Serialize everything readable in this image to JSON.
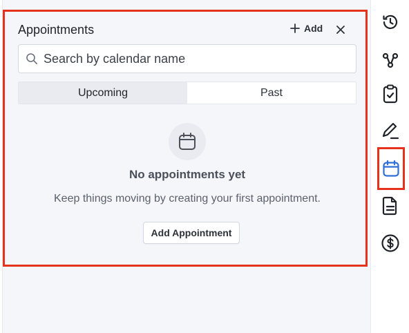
{
  "panel": {
    "title": "Appointments",
    "add_label": "Add",
    "search": {
      "placeholder": "Search by calendar name",
      "value": ""
    },
    "tabs": [
      {
        "label": "Upcoming",
        "active": true
      },
      {
        "label": "Past",
        "active": false
      }
    ],
    "empty_state": {
      "icon": "calendar-icon",
      "title": "No appointments yet",
      "description": "Keep things moving by creating your first appointment.",
      "button_label": "Add Appointment"
    }
  },
  "rail": {
    "items": [
      {
        "name": "history-icon",
        "active": false
      },
      {
        "name": "workflow-icon",
        "active": false
      },
      {
        "name": "tasks-clipboard-icon",
        "active": false
      },
      {
        "name": "pen-icon",
        "active": false
      },
      {
        "name": "calendar-icon",
        "active": true
      },
      {
        "name": "document-icon",
        "active": false
      },
      {
        "name": "payments-dollar-icon",
        "active": false
      }
    ]
  },
  "colors": {
    "highlight_border": "#e5331b",
    "active_accent": "#2f6fd6",
    "icon_dark": "#1f2328",
    "panel_bg": "#f5f6fa"
  }
}
